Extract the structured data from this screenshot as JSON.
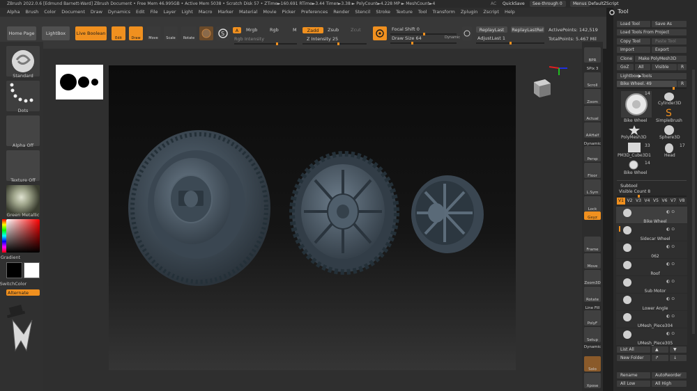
{
  "title_bar": {
    "text": "ZBrush 2022.0.6 [Edmund Barnett-Ward]   ZBrush Document   • Free Mem 46.995GB • Active Mem 5038 • Scratch Disk 57 •  ZTime►160.691 RTime►3.44 Timer►3.38 ► PolyCount►4.228 MP ► MeshCount►4",
    "ac": "AC",
    "quicksave": "QuickSave",
    "see_through": "See-through  0",
    "menus": "Menus",
    "default_zscript": "DefaultZScript"
  },
  "menu_items": [
    "Alpha",
    "Brush",
    "Color",
    "Document",
    "Draw",
    "Dynamics",
    "Edit",
    "File",
    "Layer",
    "Light",
    "Macro",
    "Marker",
    "Material",
    "Movie",
    "Picker",
    "Preferences",
    "Render",
    "Stencil",
    "Stroke",
    "Texture",
    "Tool",
    "Transform",
    "Zplugin",
    "Zscript",
    "Help"
  ],
  "toolbar": {
    "home_page": "Home Page",
    "lightbox": "LightBox",
    "live_boolean": "Live Boolean",
    "edit": "Edit",
    "draw": "Draw",
    "move": "Move",
    "scale": "Scale",
    "rotate": "Rotate",
    "a": "A",
    "mrgb": "Mrgb",
    "rgb": "Rgb",
    "m": "M",
    "rgb_intensity": "Rgb Intensity",
    "zadd": "Zadd",
    "zsub": "Zsub",
    "zcut": "Zcut",
    "z_intensity": "Z Intensity 25",
    "focal_shift": "Focal Shift 0",
    "draw_size": "Draw Size 64",
    "dynamic": "Dynamic",
    "replay_last": "ReplayLast",
    "replay_last_rel": "ReplayLastRel",
    "adjust_last": "AdjustLast 1",
    "active_points": "ActivePoints: 142,519",
    "total_points": "TotalPoints: 5.467 Mil"
  },
  "left_shelf": {
    "standard": "Standard",
    "dots": "Dots",
    "alpha_off": "Alpha Off",
    "texture_off": "Texture Off",
    "material": "Green Metallic",
    "gradient": "Gradient",
    "switch_color": "SwitchColor",
    "alternate": "Alternate"
  },
  "right_shelf": {
    "bpr": "BPR",
    "spix": "SPix 3",
    "scroll": "Scroll",
    "zoom": "Zoom",
    "actual": "Actual",
    "aahalf": "AAHalf",
    "dynamic": "Dynamic",
    "persp": "Persp",
    "floor": "Floor",
    "lsym": "L.Sym",
    "lock": "Lock",
    "gxyz": "Gxyz",
    "frame": "Frame",
    "move": "Move",
    "zoom3d": "Zoom3D",
    "rotate": "Rotate",
    "line_fill": "Line Fill",
    "polyf": "PolyF",
    "setup": "Setup",
    "dynamic2": "Dynamic",
    "solo": "Solo",
    "xpose": "Xpose"
  },
  "tool_panel": {
    "title": "Tool",
    "load_tool": "Load Tool",
    "save_as": "Save As",
    "load_tools_from_project": "Load Tools From Project",
    "copy_tool": "Copy Tool",
    "paste_tool": "Paste Tool",
    "import": "Import",
    "export": "Export",
    "clone": "Clone",
    "make_polymesh3d": "Make PolyMesh3D",
    "goz": "GoZ",
    "all": "All",
    "visible": "Visible",
    "r": "R",
    "lightbox_tools": "Lightbox▶Tools",
    "current_tool": "Bike Wheel. 49",
    "current_tool_slider": "R",
    "tools": [
      {
        "name": "Bike Wheel",
        "count": "14"
      },
      {
        "name": "Cylinder3D",
        "count": ""
      },
      {
        "name": "SimpleBrush",
        "count": ""
      },
      {
        "name": "PolyMesh3D",
        "count": ""
      },
      {
        "name": "Sphere3D",
        "count": ""
      },
      {
        "name": "PM3D_Cube3D1",
        "count": "33"
      },
      {
        "name": "Head",
        "count": "17"
      },
      {
        "name": "Bike Wheel",
        "count": "14"
      }
    ],
    "subtool_title": "Subtool",
    "visible_count": "Visible Count 8",
    "version_tabs": [
      "V1",
      "V2",
      "V3",
      "V4",
      "V5",
      "V6",
      "V7",
      "V8"
    ],
    "subtools": [
      "Bike Wheel",
      "Sidecar Wheel",
      "062",
      "Roof",
      "Sub Motor",
      "Lower Angle",
      "UMesh_Piece304",
      "UMesh_Piece305"
    ],
    "list_all": "List All",
    "new_folder": "New Folder",
    "rename": "Rename",
    "auto_reorder": "AutoReorder",
    "all_low": "All Low",
    "all_high": "All High"
  },
  "colors": {
    "accent": "#f0901f",
    "panel_bg": "#2a2a2a",
    "viewport_top": "#0b0b0b",
    "viewport_bottom": "#353535",
    "mesh": "#4a5a68"
  },
  "icons": {
    "axis_gizmo": "axis-gizmo-icon",
    "view_cube": "view-cube-icon"
  }
}
